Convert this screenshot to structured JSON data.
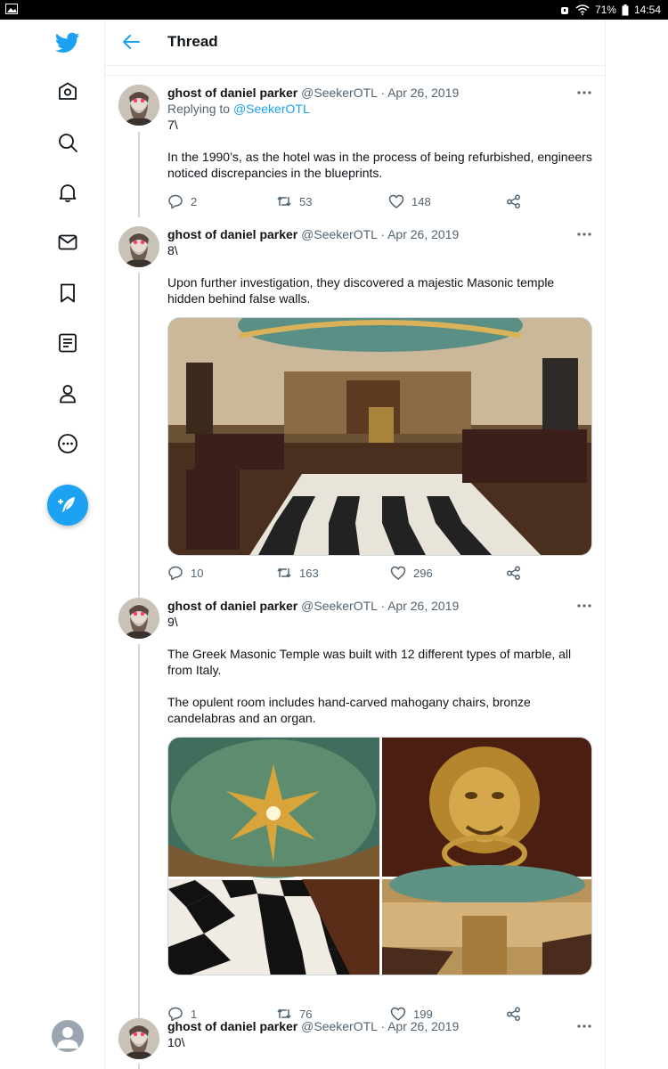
{
  "status_bar": {
    "battery": "71%",
    "time": "14:54"
  },
  "header": {
    "title": "Thread"
  },
  "sidebar": {
    "items": [
      "twitter-logo",
      "home-icon",
      "explore-icon",
      "notifications-icon",
      "messages-icon",
      "bookmarks-icon",
      "lists-icon",
      "profile-icon",
      "more-icon"
    ]
  },
  "tweets": [
    {
      "name": "ghost of daniel parker",
      "handle": "@SeekerOTL",
      "date": "· Apr 26, 2019",
      "replying_label": "Replying to",
      "replying_handle": "@SeekerOTL",
      "text": "7\\\n\nIn the 1990’s, as the hotel was in the process of being refurbished, engineers noticed discrepancies in the blueprints.",
      "replies": "2",
      "retweets": "53",
      "likes": "148"
    },
    {
      "name": "ghost of daniel parker",
      "handle": "@SeekerOTL",
      "date": "· Apr 26, 2019",
      "text": "8\\\n\nUpon further investigation, they discovered a majestic Masonic temple hidden behind false walls.",
      "replies": "10",
      "retweets": "163",
      "likes": "296"
    },
    {
      "name": "ghost of daniel parker",
      "handle": "@SeekerOTL",
      "date": "· Apr 26, 2019",
      "text": "9\\\n\nThe Greek Masonic Temple was built with 12 different types of marble, all from Italy.\n\nThe opulent room includes hand-carved mahogany chairs, bronze candelabras and an organ.",
      "replies": "1",
      "retweets": "76",
      "likes": "199"
    },
    {
      "name": "ghost of daniel parker",
      "handle": "@SeekerOTL",
      "date": "· Apr 26, 2019",
      "text": "10\\"
    }
  ]
}
